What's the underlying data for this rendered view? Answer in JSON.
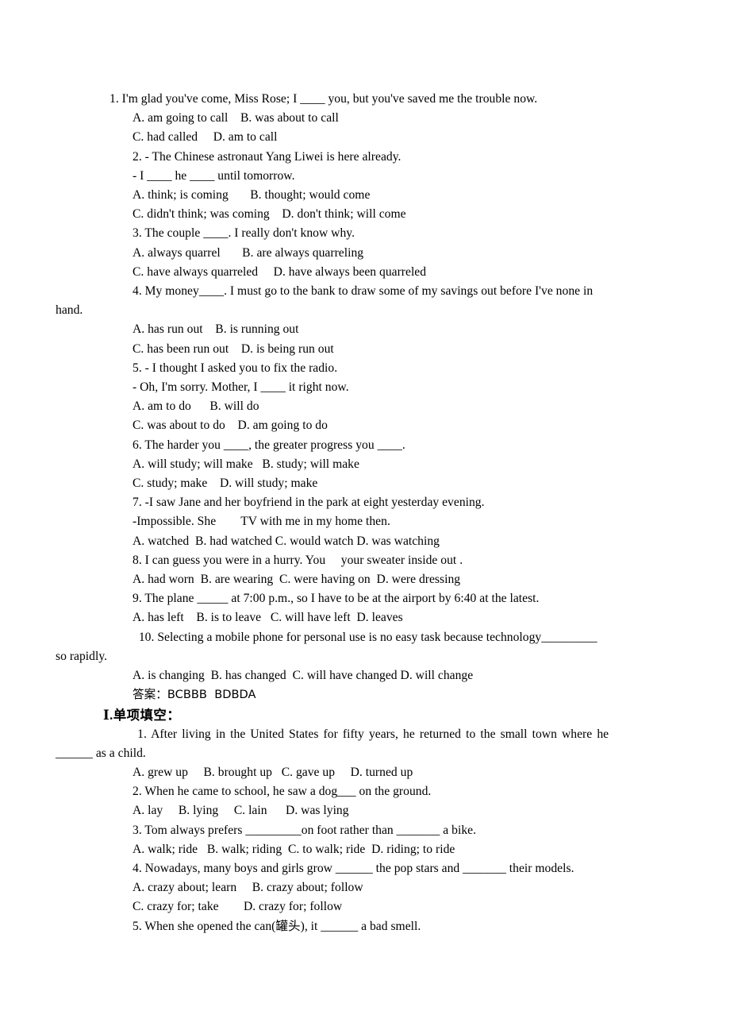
{
  "document": {
    "background_color": "#ffffff",
    "text_color": "#000000",
    "sections": [
      {
        "id": "grammar-drill",
        "lines": [
          {
            "id": "q1-stem",
            "indent": "l0",
            "text": "1. I'm glad you've come, Miss Rose; I ____ you, but you've saved me the trouble now."
          },
          {
            "id": "q1-opt-ab",
            "indent": "l1",
            "text": "A. am going to call    B. was about to call"
          },
          {
            "id": "q1-opt-cd",
            "indent": "l1",
            "text": "C. had called     D. am to call"
          },
          {
            "id": "q2-stem-a",
            "indent": "l1",
            "text": "2. - The Chinese astronaut Yang Liwei is here already."
          },
          {
            "id": "q2-stem-b",
            "indent": "l1",
            "text": "- I ____ he ____ until tomorrow."
          },
          {
            "id": "q2-opt-ab",
            "indent": "l1",
            "text": "A. think; is coming       B. thought; would come"
          },
          {
            "id": "q2-opt-cd",
            "indent": "l1",
            "text": "C. didn't think; was coming    D. don't think; will come"
          },
          {
            "id": "q3-stem",
            "indent": "l1",
            "text": "3. The couple ____. I really don't know why."
          },
          {
            "id": "q3-opt-ab",
            "indent": "l1",
            "text": "A. always quarrel       B. are always quarreling"
          },
          {
            "id": "q3-opt-cd",
            "indent": "l1",
            "text": "C. have always quarreled     D. have always been quarreled"
          },
          {
            "id": "q4-stem",
            "indent": "l1",
            "text": "4. My money____. I must go to the bank to draw some of my savings out before I've none in"
          },
          {
            "id": "q4-stem-cont",
            "indent": "hang",
            "text": "hand."
          },
          {
            "id": "q4-opt-ab",
            "indent": "l1",
            "text": "A. has run out    B. is running out"
          },
          {
            "id": "q4-opt-cd",
            "indent": "l1",
            "text": "C. has been run out    D. is being run out"
          },
          {
            "id": "q5-stem-a",
            "indent": "l1",
            "text": "5. - I thought I asked you to fix the radio."
          },
          {
            "id": "q5-stem-b",
            "indent": "l1",
            "text": "- Oh, I'm sorry. Mother, I ____ it right now."
          },
          {
            "id": "q5-opt-ab",
            "indent": "l1",
            "text": "A. am to do      B. will do"
          },
          {
            "id": "q5-opt-cd",
            "indent": "l1",
            "text": "C. was about to do    D. am going to do"
          },
          {
            "id": "q6-stem",
            "indent": "l1",
            "text": "6. The harder you ____, the greater progress you ____."
          },
          {
            "id": "q6-opt-ab",
            "indent": "l1",
            "text": "A. will study; will make   B. study; will make"
          },
          {
            "id": "q6-opt-cd",
            "indent": "l1",
            "text": "C. study; make    D. will study; make"
          },
          {
            "id": "q7-stem-a",
            "indent": "l1",
            "text": "7. -I saw Jane and her boyfriend in the park at eight yesterday evening."
          },
          {
            "id": "q7-stem-b",
            "indent": "l1",
            "text": "-Impossible. She        TV with me in my home then."
          },
          {
            "id": "q7-opts",
            "indent": "l1",
            "text": "A. watched  B. had watched C. would watch D. was watching"
          },
          {
            "id": "q8-stem",
            "indent": "l1",
            "text": "8. I can guess you were in a hurry. You     your sweater inside out ."
          },
          {
            "id": "q8-opts",
            "indent": "l1",
            "text": "A. had worn  B. are wearing  C. were having on  D. were dressing"
          },
          {
            "id": "q9-stem",
            "indent": "l1",
            "text": "9. The plane _____ at 7:00 p.m., so I have to be at the airport by 6:40 at the latest."
          },
          {
            "id": "q9-opts",
            "indent": "l1",
            "text": "A. has left    B. is to leave   C. will have left  D. leaves"
          },
          {
            "id": "q10-stem",
            "indent": "l1",
            "text": "  10. Selecting a mobile phone for personal use is no easy task because technology_________"
          },
          {
            "id": "q10-stem-cont",
            "indent": "hang",
            "text": "so rapidly."
          },
          {
            "id": "q10-opts",
            "indent": "l1",
            "text": "A. is changing  B. has changed  C. will have changed D. will change"
          },
          {
            "id": "answer-key",
            "indent": "l1",
            "text": "答案：BCBBB  BDBDA"
          }
        ]
      },
      {
        "id": "section-one",
        "heading": "Ⅰ.单项填空：",
        "lines": [
          {
            "id": "s1-q1-stem",
            "indent": "l1",
            "justify": true,
            "text": " 1. After living in the United States for fifty years, he returned to the small town where he"
          },
          {
            "id": "s1-q1-stem-cont",
            "indent": "hang",
            "text": "______ as a child."
          },
          {
            "id": "s1-q1-opts",
            "indent": "l1",
            "text": "A. grew up     B. brought up   C. gave up     D. turned up"
          },
          {
            "id": "s1-q2-stem",
            "indent": "l1",
            "text": "2. When he came to school, he saw a dog___ on the ground."
          },
          {
            "id": "s1-q2-opts",
            "indent": "l1",
            "text": "A. lay     B. lying     C. lain      D. was lying"
          },
          {
            "id": "s1-q3-stem",
            "indent": "l1",
            "text": "3. Tom always prefers _________on foot rather than _______ a bike."
          },
          {
            "id": "s1-q3-opts",
            "indent": "l1",
            "text": "A. walk; ride   B. walk; riding  C. to walk; ride  D. riding; to ride"
          },
          {
            "id": "s1-q4-stem",
            "indent": "l1",
            "text": "4. Nowadays, many boys and girls grow ______ the pop stars and _______ their models."
          },
          {
            "id": "s1-q4-opt-ab",
            "indent": "l1",
            "text": "A. crazy about; learn     B. crazy about; follow"
          },
          {
            "id": "s1-q4-opt-cd",
            "indent": "l1",
            "text": "C. crazy for; take        D. crazy for; follow"
          },
          {
            "id": "s1-q5-stem",
            "indent": "l1",
            "text": "5. When she opened the can(罐头), it ______ a bad smell."
          }
        ]
      }
    ]
  }
}
